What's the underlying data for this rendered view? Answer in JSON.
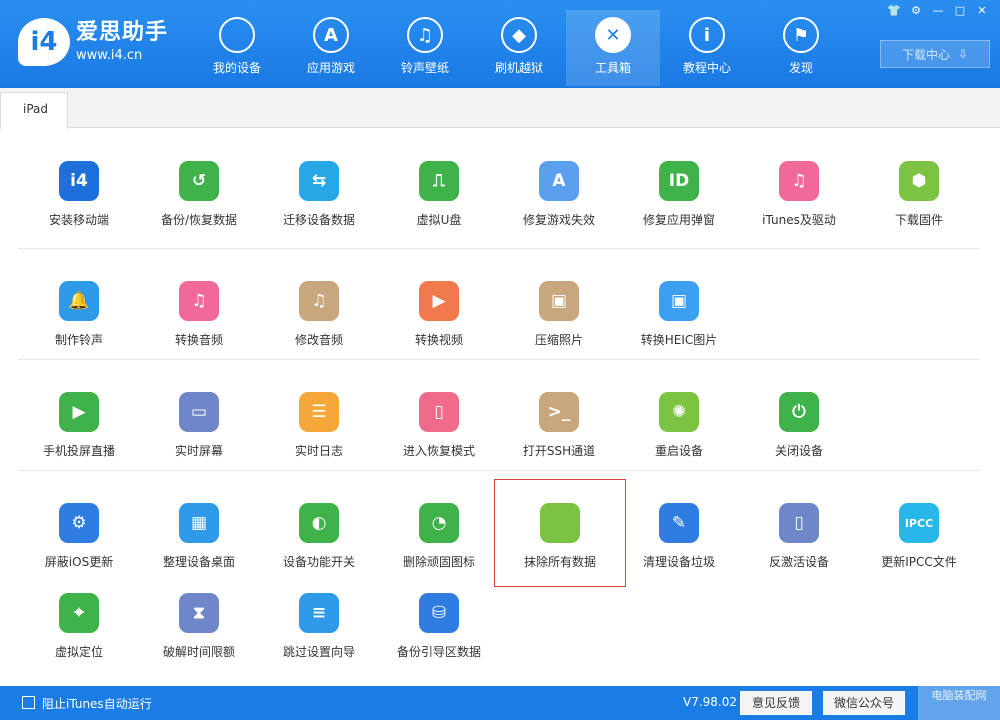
{
  "brand": {
    "logo": "i4",
    "name": "爱思助手",
    "url": "www.i4.cn"
  },
  "nav": [
    {
      "label": "我的设备",
      "icon": "apple-icon",
      "glyph": ""
    },
    {
      "label": "应用游戏",
      "icon": "app-store-icon",
      "glyph": "A"
    },
    {
      "label": "铃声壁纸",
      "icon": "music-icon",
      "glyph": "♫"
    },
    {
      "label": "刷机越狱",
      "icon": "dropbox-icon",
      "glyph": "◆"
    },
    {
      "label": "工具箱",
      "icon": "tools-icon",
      "glyph": "✕"
    },
    {
      "label": "教程中心",
      "icon": "info-icon",
      "glyph": "i"
    },
    {
      "label": "发现",
      "icon": "flag-icon",
      "glyph": "⚑"
    }
  ],
  "window_controls": [
    "👕",
    "⚙",
    "—",
    "□",
    "✕"
  ],
  "download_center": {
    "label": "下载中心",
    "icon": "⇩"
  },
  "device_tab": "iPad",
  "tools": [
    {
      "label": "安装移动端",
      "color": "#1e6fd9",
      "glyph": "i4"
    },
    {
      "label": "备份/恢复数据",
      "color": "#3fb24a",
      "glyph": "↺"
    },
    {
      "label": "迁移设备数据",
      "color": "#27a7e6",
      "glyph": "⇆"
    },
    {
      "label": "虚拟U盘",
      "color": "#3fb24a",
      "glyph": "⎍"
    },
    {
      "label": "修复游戏失效",
      "color": "#5aa0ee",
      "glyph": "A"
    },
    {
      "label": "修复应用弹窗",
      "color": "#3fb24a",
      "glyph": "ID"
    },
    {
      "label": "iTunes及驱动",
      "color": "#f0699a",
      "glyph": "♫"
    },
    {
      "label": "下载固件",
      "color": "#7cc243",
      "glyph": "⬢"
    },
    {
      "label": "制作铃声",
      "color": "#2f9be8",
      "glyph": "🔔"
    },
    {
      "label": "转换音频",
      "color": "#f0699a",
      "glyph": "♫"
    },
    {
      "label": "修改音频",
      "color": "#c8a67e",
      "glyph": "♫"
    },
    {
      "label": "转换视频",
      "color": "#f07a4c",
      "glyph": "▶"
    },
    {
      "label": "压缩照片",
      "color": "#c8a67e",
      "glyph": "▣"
    },
    {
      "label": "转换HEIC图片",
      "color": "#3d9ff0",
      "glyph": "▣"
    },
    {
      "label": "手机投屏直播",
      "color": "#3fb24a",
      "glyph": "▶"
    },
    {
      "label": "实时屏幕",
      "color": "#6f86c9",
      "glyph": "▭"
    },
    {
      "label": "实时日志",
      "color": "#f5a83a",
      "glyph": "☰"
    },
    {
      "label": "进入恢复模式",
      "color": "#f06a8a",
      "glyph": "▯"
    },
    {
      "label": "打开SSH通道",
      "color": "#c8a67e",
      "glyph": ">_"
    },
    {
      "label": "重启设备",
      "color": "#7cc243",
      "glyph": "✺"
    },
    {
      "label": "关闭设备",
      "color": "#3fb24a",
      "glyph": "⏻"
    },
    {
      "label": "屏蔽iOS更新",
      "color": "#2f7de0",
      "glyph": "⚙"
    },
    {
      "label": "整理设备桌面",
      "color": "#2f9be8",
      "glyph": "▦"
    },
    {
      "label": "设备功能开关",
      "color": "#3fb24a",
      "glyph": "◐"
    },
    {
      "label": "删除顽固图标",
      "color": "#3fb24a",
      "glyph": "◔"
    },
    {
      "label": "抹除所有数据",
      "color": "#7cc243",
      "glyph": ""
    },
    {
      "label": "清理设备垃圾",
      "color": "#2f7de0",
      "glyph": "✎"
    },
    {
      "label": "反激活设备",
      "color": "#6f86c9",
      "glyph": "▯"
    },
    {
      "label": "更新IPCC文件",
      "color": "#29b6e8",
      "glyph": "IPCC"
    },
    {
      "label": "虚拟定位",
      "color": "#3fb24a",
      "glyph": "⌖"
    },
    {
      "label": "破解时间限额",
      "color": "#6f86c9",
      "glyph": "⧗"
    },
    {
      "label": "跳过设置向导",
      "color": "#2f9be8",
      "glyph": "≡"
    },
    {
      "label": "备份引导区数据",
      "color": "#2f7de0",
      "glyph": "⛁"
    }
  ],
  "footer": {
    "checkbox_label": "阻止iTunes自动运行",
    "version": "V7.98.02",
    "feedback": "意见反馈",
    "wechat": "微信公众号",
    "watermark": "电脑装配网"
  }
}
